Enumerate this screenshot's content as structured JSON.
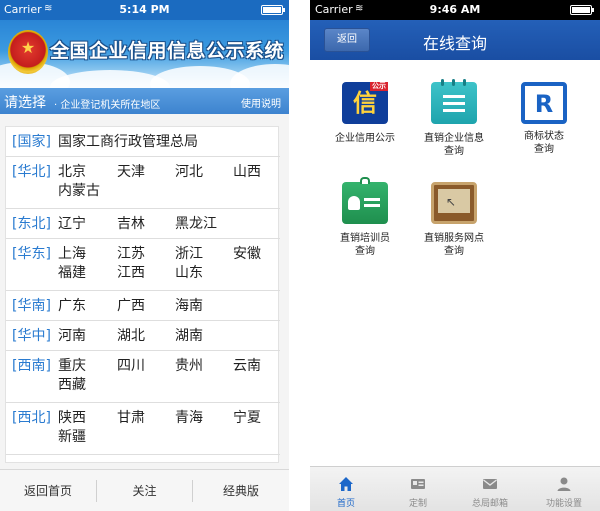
{
  "left": {
    "status": {
      "carrier": "Carrier",
      "time": "5:14 PM"
    },
    "banner": {
      "title": "全国企业信用信息公示系统"
    },
    "selector": {
      "choose": "请选择",
      "hint": "· 企业登记机关所在地区",
      "help": "使用说明"
    },
    "regions": [
      {
        "region": "[国家]",
        "provinces": [
          "国家工商行政管理总局"
        ]
      },
      {
        "region": "[华北]",
        "provinces": [
          "北京",
          "天津",
          "河北",
          "山西",
          "内蒙古"
        ]
      },
      {
        "region": "[东北]",
        "provinces": [
          "辽宁",
          "吉林",
          "黑龙江"
        ]
      },
      {
        "region": "[华东]",
        "provinces": [
          "上海",
          "江苏",
          "浙江",
          "安徽",
          "福建",
          "江西",
          "山东"
        ]
      },
      {
        "region": "[华南]",
        "provinces": [
          "广东",
          "广西",
          "海南"
        ]
      },
      {
        "region": "[华中]",
        "provinces": [
          "河南",
          "湖北",
          "湖南"
        ]
      },
      {
        "region": "[西南]",
        "provinces": [
          "重庆",
          "四川",
          "贵州",
          "云南",
          "西藏"
        ]
      },
      {
        "region": "[西北]",
        "provinces": [
          "陕西",
          "甘肃",
          "青海",
          "宁夏",
          "新疆"
        ]
      }
    ],
    "tabbar": {
      "home": "返回首页",
      "follow": "关注",
      "classic": "经典版"
    }
  },
  "right": {
    "status": {
      "carrier": "Carrier",
      "time": "9:46 AM"
    },
    "nav": {
      "back": "返回",
      "title": "在线查询"
    },
    "items": [
      {
        "label": "企业信用公示",
        "icon": "credit-icon",
        "glyph": "信",
        "tag": "公示"
      },
      {
        "label": "直销企业信息\n查询",
        "icon": "notebook-icon"
      },
      {
        "label": "商标状态\n查询",
        "icon": "registered-trademark-icon",
        "glyph": "R"
      },
      {
        "label": "直销培训员\n查询",
        "icon": "id-badge-icon"
      },
      {
        "label": "直销服务网点\n查询",
        "icon": "board-icon"
      }
    ],
    "tabs": [
      {
        "label": "首页",
        "icon": "home-icon",
        "active": true
      },
      {
        "label": "定制",
        "icon": "custom-card-icon",
        "active": false
      },
      {
        "label": "总局邮箱",
        "icon": "mail-icon",
        "active": false
      },
      {
        "label": "功能设置",
        "icon": "user-settings-icon",
        "active": false
      }
    ],
    "colors": {
      "nav": "#1a4ea3",
      "active_tab": "#1c67c9"
    }
  }
}
